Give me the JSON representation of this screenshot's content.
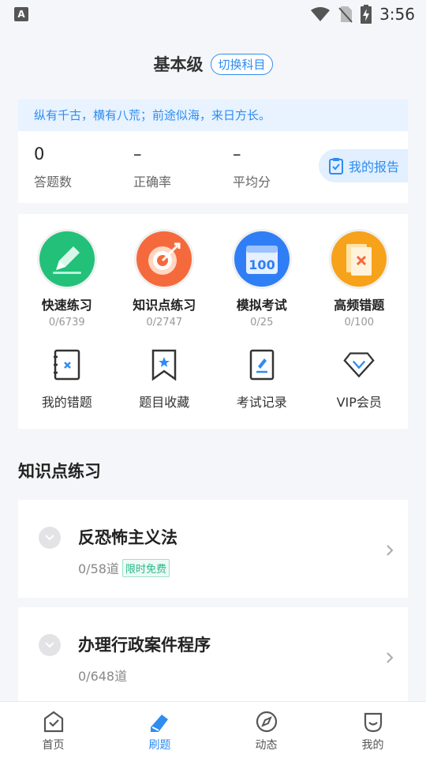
{
  "status_bar": {
    "time": "3:56",
    "left_badge": "A"
  },
  "header": {
    "title": "基本级",
    "switch_label": "切换科目"
  },
  "stats": {
    "motto": "纵有千古，横有八荒；前途似海，来日方长。",
    "items": [
      {
        "value": "0",
        "label": "答题数"
      },
      {
        "value": "–",
        "label": "正确率"
      },
      {
        "value": "–",
        "label": "平均分"
      }
    ],
    "report_label": "我的报告"
  },
  "practice_modes": [
    {
      "label": "快速练习",
      "count": "0/6739",
      "icon": "pencil-icon",
      "color": "#23c07a"
    },
    {
      "label": "知识点练习",
      "count": "0/2747",
      "icon": "target-icon",
      "color": "#f56a3c"
    },
    {
      "label": "模拟考试",
      "count": "0/25",
      "icon": "calendar-100-icon",
      "color": "#2f7ef5"
    },
    {
      "label": "高频错题",
      "count": "0/100",
      "icon": "wrong-card-icon",
      "color": "#f7a21b"
    }
  ],
  "shortcuts": [
    {
      "label": "我的错题",
      "icon": "wrong-note-icon"
    },
    {
      "label": "题目收藏",
      "icon": "bookmark-icon"
    },
    {
      "label": "考试记录",
      "icon": "exam-record-icon"
    },
    {
      "label": "VIP会员",
      "icon": "diamond-icon"
    }
  ],
  "calendar_badge": "100",
  "section_title": "知识点练习",
  "topics": [
    {
      "name": "反恐怖主义法",
      "count": "0/58道",
      "tag": "限时免费"
    },
    {
      "name": "办理行政案件程序",
      "count": "0/648道",
      "tag": ""
    }
  ],
  "tabs": [
    {
      "label": "首页",
      "icon": "home-check-icon",
      "active": false
    },
    {
      "label": "刷题",
      "icon": "pen-tab-icon",
      "active": true
    },
    {
      "label": "动态",
      "icon": "compass-icon",
      "active": false
    },
    {
      "label": "我的",
      "icon": "profile-icon",
      "active": false
    }
  ],
  "colors": {
    "accent": "#2f8cf0",
    "tag_green": "#27b88a"
  }
}
